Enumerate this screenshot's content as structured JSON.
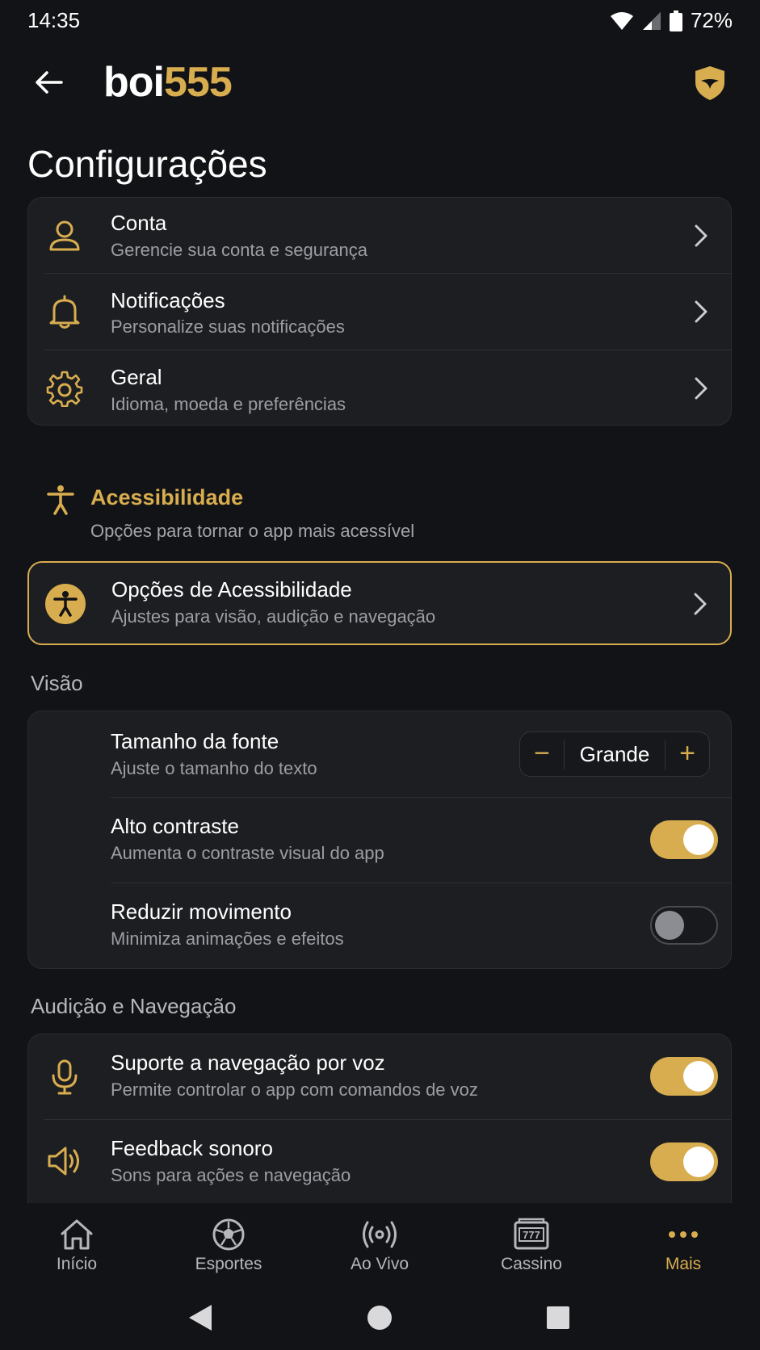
{
  "status_bar": {
    "time": "14:35",
    "battery": "72%"
  },
  "header": {
    "logo_part1": "boi",
    "logo_part2": "555"
  },
  "page_title": "Configurações",
  "settings": [
    {
      "title": "Conta",
      "subtitle": "Gerencie sua conta e segurança",
      "icon": "user-icon"
    },
    {
      "title": "Notificações",
      "subtitle": "Personalize suas notificações",
      "icon": "bell-icon"
    },
    {
      "title": "Geral",
      "subtitle": "Idioma, moeda e preferências",
      "icon": "gear-icon"
    }
  ],
  "accessibility": {
    "heading": "Acessibilidade",
    "description": "Opções para tornar o app mais acessível",
    "options_title": "Opções de Acessibilidade",
    "options_subtitle": "Ajustes para visão, audição e navegação"
  },
  "vision": {
    "label": "Visão",
    "font_size": {
      "title": "Tamanho da fonte",
      "subtitle": "Ajuste o tamanho do texto",
      "value": "Grande",
      "minus": "−",
      "plus": "+"
    },
    "high_contrast": {
      "title": "Alto contraste",
      "subtitle": "Aumenta o contraste visual do app",
      "on": true
    },
    "reduce_motion": {
      "title": "Reduzir movimento",
      "subtitle": "Minimiza animações e efeitos",
      "on": false
    }
  },
  "hearing": {
    "label": "Audição e Navegação",
    "voice_nav": {
      "title": "Suporte a navegação por voz",
      "subtitle": "Permite controlar o app com comandos de voz",
      "on": true
    },
    "sound_feedback": {
      "title": "Feedback sonoro",
      "subtitle": "Sons para ações e navegação",
      "on": true
    }
  },
  "bottom_nav": [
    {
      "label": "Início",
      "icon": "home-icon"
    },
    {
      "label": "Esportes",
      "icon": "soccer-ball-icon"
    },
    {
      "label": "Ao Vivo",
      "icon": "live-broadcast-icon"
    },
    {
      "label": "Cassino",
      "icon": "slot-machine-icon"
    },
    {
      "label": "Mais",
      "icon": "more-dots-icon",
      "active": true
    }
  ],
  "colors": {
    "accent": "#d8ad4f",
    "background": "#121316",
    "card": "#1d1e22"
  }
}
